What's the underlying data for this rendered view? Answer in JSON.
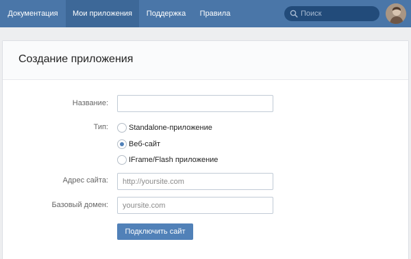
{
  "nav": {
    "items": [
      {
        "label": "Документация"
      },
      {
        "label": "Мои приложения"
      },
      {
        "label": "Поддержка"
      },
      {
        "label": "Правила"
      }
    ],
    "search": {
      "placeholder": "Поиск",
      "icon": "search-icon"
    },
    "avatar": {
      "icon": "user-avatar"
    }
  },
  "page": {
    "title": "Создание приложения"
  },
  "form": {
    "name": {
      "label": "Название:",
      "value": ""
    },
    "type": {
      "label": "Тип:",
      "options": [
        {
          "label": "Standalone-приложение",
          "selected": false
        },
        {
          "label": "Веб-сайт",
          "selected": true
        },
        {
          "label": "IFrame/Flash приложение",
          "selected": false
        }
      ]
    },
    "site_address": {
      "label": "Адрес сайта:",
      "placeholder": "http://yoursite.com",
      "value": ""
    },
    "base_domain": {
      "label": "Базовый домен:",
      "placeholder": "yoursite.com",
      "value": ""
    },
    "submit_label": "Подключить сайт"
  },
  "colors": {
    "header_bg": "#4a76a8",
    "active_tab_bg": "#3d6898",
    "page_bg": "#edeef0",
    "accent": "#5181b8"
  }
}
